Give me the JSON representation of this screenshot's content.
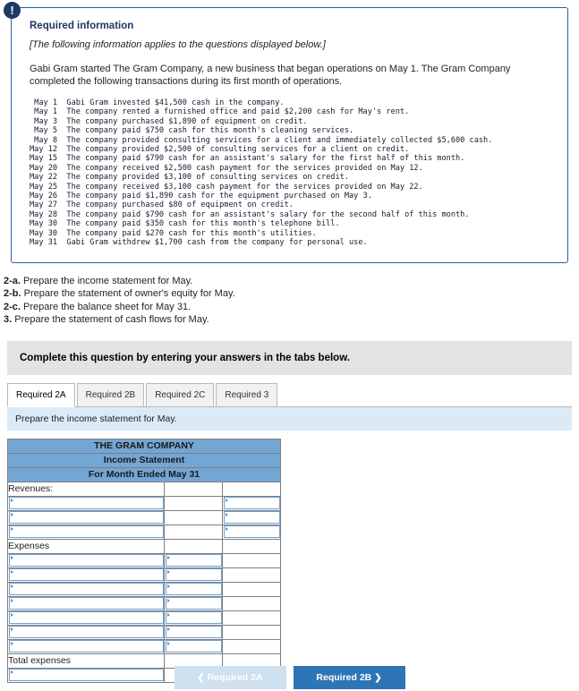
{
  "panel": {
    "badge_icon": "exclamation-icon",
    "badge_text": "!",
    "title": "Required information",
    "subtitle": "[The following information applies to the questions displayed below.]",
    "intro": "Gabi Gram started The Gram Company, a new business that began operations on May 1. The Gram Company completed the following transactions during its first month of operations.",
    "transactions": [
      " May 1  Gabi Gram invested $41,500 cash in the company.",
      " May 1  The company rented a furnished office and paid $2,200 cash for May's rent.",
      " May 3  The company purchased $1,890 of equipment on credit.",
      " May 5  The company paid $750 cash for this month's cleaning services.",
      " May 8  The company provided consulting services for a client and immediately collected $5,600 cash.",
      "May 12  The company provided $2,500 of consulting services for a client on credit.",
      "May 15  The company paid $790 cash for an assistant's salary for the first half of this month.",
      "May 20  The company received $2,500 cash payment for the services provided on May 12.",
      "May 22  The company provided $3,100 of consulting services on credit.",
      "May 25  The company received $3,100 cash payment for the services provided on May 22.",
      "May 26  The company paid $1,890 cash for the equipment purchased on May 3.",
      "May 27  The company purchased $80 of equipment on credit.",
      "May 28  The company paid $790 cash for an assistant's salary for the second half of this month.",
      "May 30  The company paid $350 cash for this month's telephone bill.",
      "May 30  The company paid $270 cash for this month's utilities.",
      "May 31  Gabi Gram withdrew $1,700 cash from the company for personal use."
    ]
  },
  "requirements": [
    {
      "num": "2-a.",
      "text": " Prepare the income statement for May."
    },
    {
      "num": "2-b.",
      "text": " Prepare the statement of owner's equity for May."
    },
    {
      "num": "2-c.",
      "text": " Prepare the balance sheet for May 31."
    },
    {
      "num": "3.",
      "text": " Prepare the statement of cash flows for May."
    }
  ],
  "complete_bar": "Complete this question by entering your answers in the tabs below.",
  "tabs": [
    {
      "label": "Required 2A",
      "active": true
    },
    {
      "label": "Required 2B",
      "active": false
    },
    {
      "label": "Required 2C",
      "active": false
    },
    {
      "label": "Required 3",
      "active": false
    }
  ],
  "tab_prompt": "Prepare the income statement for May.",
  "statement": {
    "header": [
      "THE GRAM COMPANY",
      "Income Statement",
      "For Month Ended May 31"
    ],
    "revenues_label": "Revenues:",
    "expenses_label": "Expenses",
    "total_expenses_label": "Total expenses",
    "revenue_rows": 3,
    "expense_rows": 7
  },
  "nav": {
    "prev_label": "Required 2A",
    "prev_icon": "chevron-left-icon",
    "next_label": "Required 2B",
    "next_icon": "chevron-right-icon"
  },
  "colors": {
    "panel_border": "#2c5f9e",
    "title_blue": "#1f3864",
    "table_header_blue": "#74a6d4",
    "prompt_blue": "#dbeaf7",
    "next_button_blue": "#2e75b6",
    "prev_button_blue": "#cfe0ee",
    "grey_bar": "#e3e3e3"
  }
}
